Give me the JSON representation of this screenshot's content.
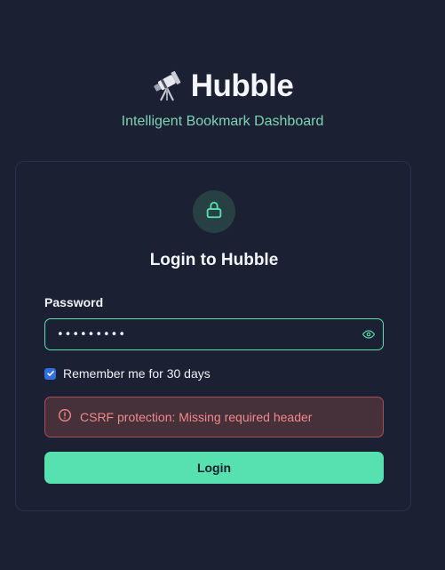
{
  "brand": {
    "title": "Hubble",
    "subtitle": "Intelligent Bookmark Dashboard",
    "logo_icon": "telescope-icon"
  },
  "login": {
    "title": "Login to Hubble",
    "lock_icon": "lock-icon",
    "password_label": "Password",
    "password_value": "•••••••••",
    "reveal_icon": "eye-icon",
    "remember_label": "Remember me for 30 days",
    "remember_checked": true,
    "error_icon": "alert-circle-icon",
    "error_message": "CSRF protection: Missing required header",
    "submit_label": "Login"
  },
  "colors": {
    "background": "#1b2032",
    "accent": "#57e0b0",
    "subtitle": "#7fd3b5",
    "error_text": "#f08a8a",
    "error_bg": "#46303a",
    "error_border": "#a85058",
    "checkbox": "#2f6fe0"
  }
}
